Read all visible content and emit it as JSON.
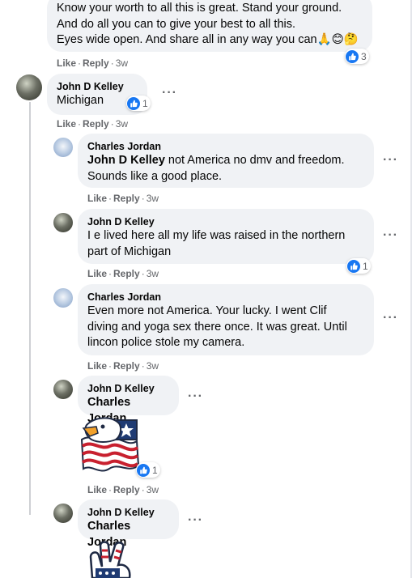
{
  "comments": {
    "c0": {
      "lines": [
        "Know your worth to all this is great. Stand your ground.",
        "And do all you can to give your best to all this.",
        "Eyes wide open. And share all in any way you can🙏😊🤔"
      ],
      "reaction_count": "3",
      "actions": {
        "like": "Like",
        "reply": "Reply",
        "time": "3w"
      }
    },
    "c1": {
      "author": "John D Kelley",
      "text": "Michigan",
      "reaction_count": "1",
      "actions": {
        "like": "Like",
        "reply": "Reply",
        "time": "3w"
      }
    },
    "c2": {
      "author": "Charles Jordan",
      "mention": "John D Kelley",
      "text_after_mention": " not America no dmv and freedom.",
      "line2": "Sounds like a good place.",
      "actions": {
        "like": "Like",
        "reply": "Reply",
        "time": "3w"
      }
    },
    "c3": {
      "author": "John D Kelley",
      "line1": "I e lived here all my life was raised in the northern",
      "line2": "part of Michigan",
      "reaction_count": "1",
      "actions": {
        "like": "Like",
        "reply": "Reply",
        "time": "3w"
      }
    },
    "c4": {
      "author": "Charles Jordan",
      "line1": "Even more not America. Your lucky. I went Clif",
      "line2": "diving and yoga sex there once. It was great. Until",
      "line3": "lincon police stole my camera.",
      "actions": {
        "like": "Like",
        "reply": "Reply",
        "time": "3w"
      }
    },
    "c5": {
      "author": "John D Kelley",
      "mention": "Charles Jordan",
      "sticker": "patriotic-eagle-sticker",
      "reaction_count": "1",
      "actions": {
        "like": "Like",
        "reply": "Reply",
        "time": "3w"
      }
    },
    "c6": {
      "author": "John D Kelley",
      "mention": "Charles Jordan",
      "sticker": "peace-hand-flag-sticker"
    }
  },
  "icons": {
    "like_badge": "like-icon",
    "more": "more-options-icon"
  },
  "colors": {
    "bubble_bg": "#f0f2f5",
    "meta_text": "#65676b",
    "like_blue": "#1877f2"
  }
}
